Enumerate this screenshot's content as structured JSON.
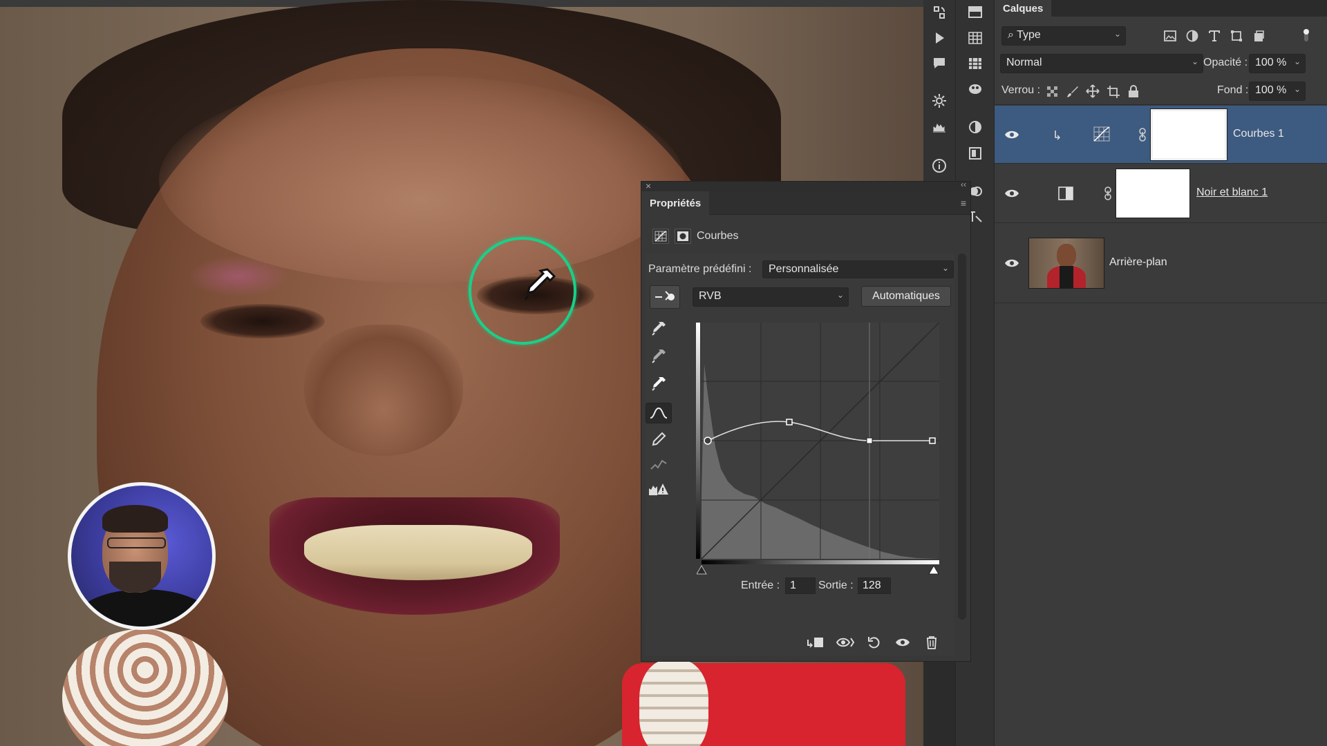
{
  "properties": {
    "tab_title": "Propriétés",
    "adjustment_type": "Courbes",
    "preset_label": "Paramètre prédéfini :",
    "preset_value": "Personnalisée",
    "channel_value": "RVB",
    "auto_button": "Automatiques",
    "input_label": "Entrée :",
    "input_value": "1",
    "output_label": "Sortie :",
    "output_value": "128"
  },
  "layers": {
    "tab_title": "Calques",
    "filter_value": "Type",
    "blend_mode": "Normal",
    "opacity_label": "Opacité :",
    "opacity_value": "100 %",
    "lock_label": "Verrou :",
    "fill_label": "Fond :",
    "fill_value": "100 %",
    "items": [
      {
        "name": "Courbes 1",
        "selected": true
      },
      {
        "name": "Noir et blanc 1",
        "selected": false
      },
      {
        "name": "Arrière-plan",
        "selected": false
      }
    ]
  },
  "colors": {
    "accent_ring": "#19d08a",
    "selection": "#3d5a80",
    "panel_bg": "#383838"
  },
  "icons": [
    "eyedropper-icon",
    "curves-icon",
    "mask-icon",
    "eye-icon",
    "link-icon",
    "trash-icon",
    "reset-icon",
    "clip-icon",
    "lock-icon",
    "search-icon"
  ]
}
